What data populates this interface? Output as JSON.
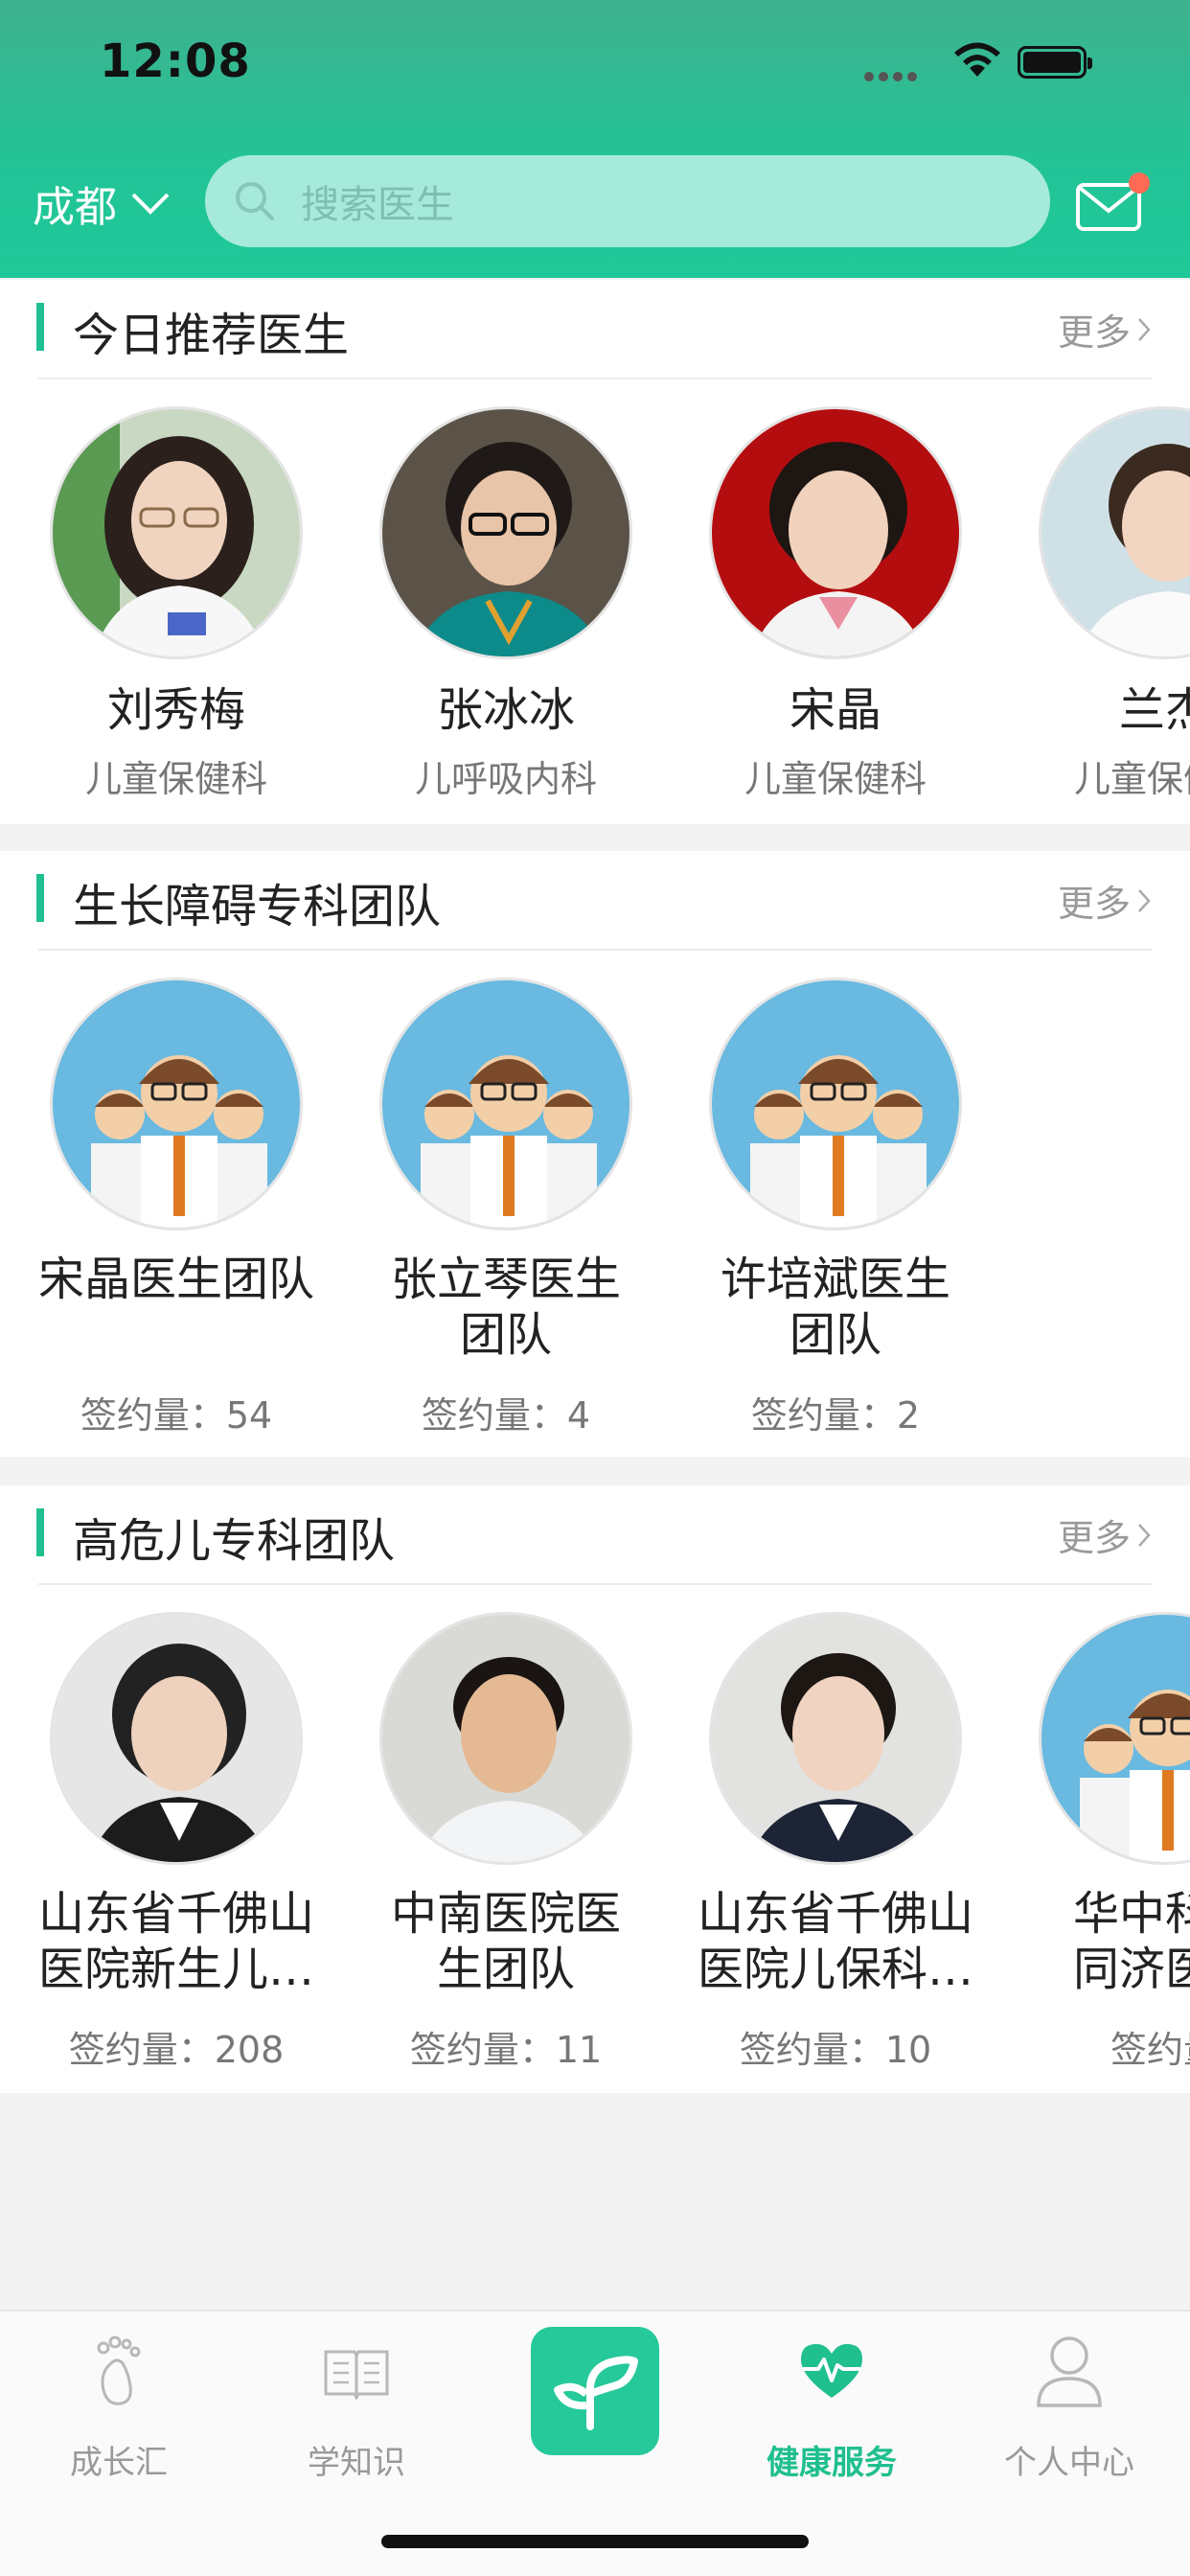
{
  "status_bar": {
    "time": "12:08"
  },
  "header": {
    "city": "成都",
    "search_placeholder": "搜索医生"
  },
  "sections": [
    {
      "title": "今日推荐医生",
      "more": "更多",
      "items": [
        {
          "name": "刘秀梅",
          "sub": "儿童保健科"
        },
        {
          "name": "张冰冰",
          "sub": "儿呼吸内科"
        },
        {
          "name": "宋晶",
          "sub": "儿童保健科"
        },
        {
          "name": "兰杰",
          "sub": "儿童保健科"
        }
      ]
    },
    {
      "title": "生长障碍专科团队",
      "more": "更多",
      "items": [
        {
          "name_l1": "宋晶医生团队",
          "name_l2": "",
          "count": "签约量：54"
        },
        {
          "name_l1": "张立琴医生",
          "name_l2": "团队",
          "count": "签约量：4"
        },
        {
          "name_l1": "许培斌医生",
          "name_l2": "团队",
          "count": "签约量：2"
        }
      ]
    },
    {
      "title": "高危儿专科团队",
      "more": "更多",
      "items": [
        {
          "name_l1": "山东省千佛山",
          "name_l2": "医院新生儿…",
          "count": "签约量：208"
        },
        {
          "name_l1": "中南医院医",
          "name_l2": "生团队",
          "count": "签约量：11"
        },
        {
          "name_l1": "山东省千佛山",
          "name_l2": "医院儿保科…",
          "count": "签约量：10"
        },
        {
          "name_l1": "华中科技",
          "name_l2": "同济医院",
          "count": "签约量"
        }
      ]
    }
  ],
  "tabbar": {
    "items": [
      {
        "label": "成长汇",
        "icon": "footprint-icon"
      },
      {
        "label": "学知识",
        "icon": "book-icon"
      },
      {
        "label": "",
        "icon": "sprout-icon"
      },
      {
        "label": "健康服务",
        "icon": "heart-pulse-icon"
      },
      {
        "label": "个人中心",
        "icon": "person-icon"
      }
    ],
    "active_index": 3
  },
  "colors": {
    "brand": "#20c090",
    "header": "#22c497",
    "accent_dot": "#ff6a55"
  }
}
